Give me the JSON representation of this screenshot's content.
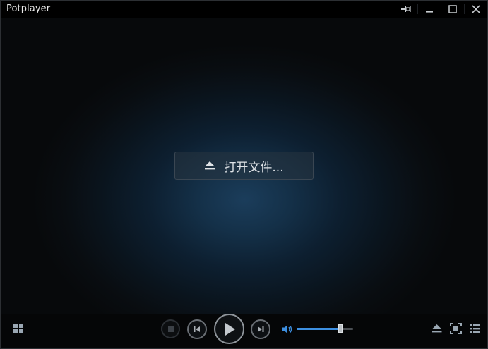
{
  "window": {
    "title": "Potplayer"
  },
  "title_buttons": {
    "pin": "pin-icon",
    "minimize": "minimize-icon",
    "maximize": "maximize-icon",
    "close": "close-icon"
  },
  "center": {
    "open_file_label": "打开文件...",
    "icon": "eject-icon"
  },
  "controls": {
    "left": [
      "grid-icon"
    ],
    "playback": [
      "stop-icon",
      "previous-icon",
      "play-icon",
      "next-icon"
    ],
    "volume_level": 0.77,
    "right": [
      "eject-icon",
      "fullscreen-icon",
      "menu-list-icon"
    ]
  },
  "colors": {
    "accent": "#3d8fe0",
    "glow": "#1b3d5b",
    "background": "#07090b"
  }
}
